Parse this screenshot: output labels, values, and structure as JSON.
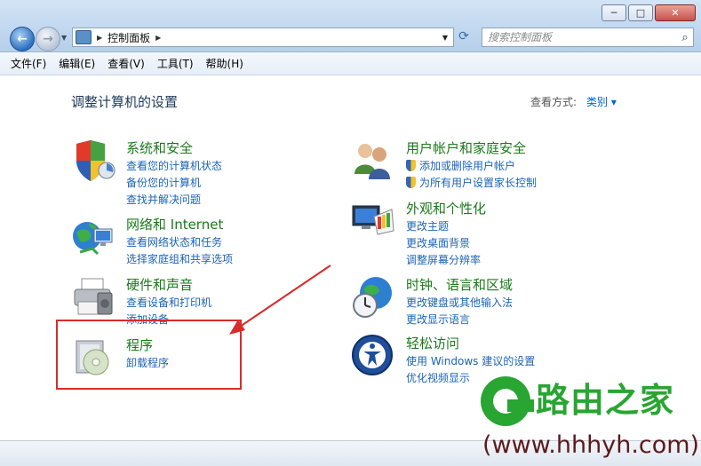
{
  "window": {
    "minimize": "─",
    "maximize": "□",
    "close": "✕"
  },
  "address_bar": {
    "crumb": "控制面板"
  },
  "search": {
    "placeholder": "搜索控制面板"
  },
  "menu": [
    "文件(F)",
    "编辑(E)",
    "查看(V)",
    "工具(T)",
    "帮助(H)"
  ],
  "main": {
    "title": "调整计算机的设置",
    "view_by_label": "查看方式:",
    "view_by_value": "类别 ▾"
  },
  "categories_left": [
    {
      "title": "系统和安全",
      "icon": "shield-icon",
      "links": [
        "查看您的计算机状态",
        "备份您的计算机",
        "查找并解决问题"
      ]
    },
    {
      "title": "网络和 Internet",
      "icon": "network-globe-icon",
      "links": [
        "查看网络状态和任务",
        "选择家庭组和共享选项"
      ]
    },
    {
      "title": "硬件和声音",
      "icon": "printer-icon",
      "links": [
        "查看设备和打印机",
        "添加设备"
      ]
    },
    {
      "title": "程序",
      "icon": "programs-disc-icon",
      "links": [
        "卸载程序"
      ]
    }
  ],
  "categories_right": [
    {
      "title": "用户帐户和家庭安全",
      "icon": "users-icon",
      "links": [
        "添加或删除用户帐户",
        "为所有用户设置家长控制"
      ]
    },
    {
      "title": "外观和个性化",
      "icon": "display-palette-icon",
      "links": [
        "更改主题",
        "更改桌面背景",
        "调整屏幕分辨率"
      ]
    },
    {
      "title": "时钟、语言和区域",
      "icon": "clock-globe-icon",
      "links": [
        "更改键盘或其他输入法",
        "更改显示语言"
      ]
    },
    {
      "title": "轻松访问",
      "icon": "ease-of-access-icon",
      "links": [
        "使用 Windows 建议的设置",
        "优化视频显示"
      ]
    }
  ],
  "watermark": {
    "brand": "路由之家",
    "url": "(www.hhhyh.com)"
  },
  "colors": {
    "category_title": "#1a7a1a",
    "link": "#1b64b8",
    "highlight": "#d92b2b",
    "watermark_green": "#29a532"
  }
}
